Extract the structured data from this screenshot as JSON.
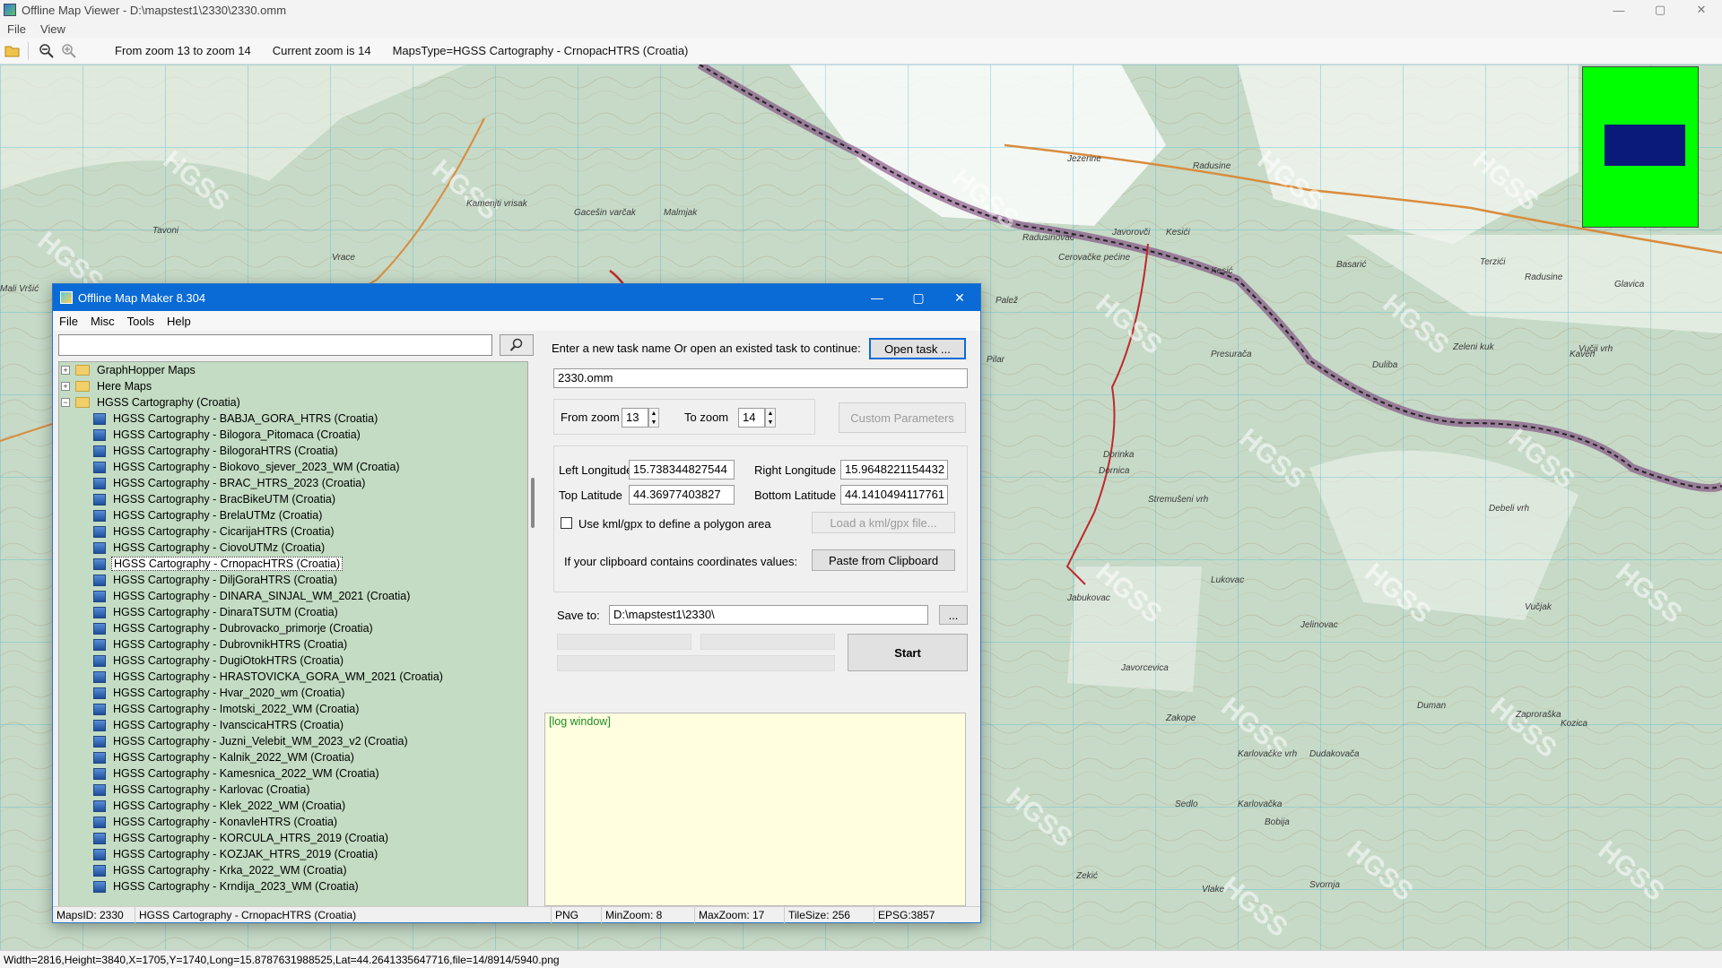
{
  "window": {
    "title": "Offline Map Viewer - D:\\mapstest1\\2330\\2330.omm",
    "controls": [
      "—",
      "▢",
      "✕"
    ]
  },
  "menu": [
    "File",
    "View"
  ],
  "toolbar": {
    "zoom_range": "From zoom 13 to zoom 14",
    "current_zoom": "Current zoom is 14",
    "maps_type": "MapsType=HGSS Cartography - CrnopacHTRS (Croatia)",
    "icons": [
      "open-folder-icon",
      "zoom-out-icon",
      "zoom-in-icon"
    ]
  },
  "map": {
    "watermark": "HGSS",
    "labels": [
      "Tavoni",
      "Vrace",
      "Kamenjti vrisak",
      "Gacešin varčak",
      "Malmjak",
      "Jezerine",
      "Radusinovac",
      "Radusine",
      "Cerovačke pećine",
      "Palež",
      "Javorovči",
      "Kesići",
      "Kesić",
      "Terzići",
      "Radusine",
      "Glavica",
      "Basarić",
      "Vučji vrh",
      "Mali Vršić",
      "Dorinka",
      "Presurača",
      "Duliba",
      "Kaven",
      "Lukovac",
      "Jabukovac",
      "Jelinovac",
      "Javorcevica",
      "Duman",
      "Zaproraška",
      "Vučjak",
      "Kozica",
      "Zakope",
      "Dudakovača",
      "Karlovačke vrh",
      "Vlake",
      "Zekić",
      "Svornja",
      "Sedlo",
      "Bobija",
      "Zeleni kuk",
      "Debeli vrh",
      "Karlovačka",
      "Stremušeni vrh",
      "Dornica",
      "Pilar"
    ],
    "overview": {
      "bg": "#00ff00",
      "viewport": "#0a1a7a"
    }
  },
  "statusbar": "Width=2816,Height=3840,X=1705,Y=1740,Long=15.8787631988525,Lat=44.2641335647716,file=14/8914/5940.png",
  "dialog": {
    "title": "Offline Map Maker 8.304",
    "menu": [
      "File",
      "Misc",
      "Tools",
      "Help"
    ],
    "search_value": "",
    "tree": {
      "folders": [
        {
          "label": "GraphHopper Maps",
          "expander": "+"
        },
        {
          "label": "Here Maps",
          "expander": "+"
        },
        {
          "label": "HGSS Cartography (Croatia)",
          "expander": "−"
        }
      ],
      "children": [
        "HGSS Cartography - BABJA_GORA_HTRS (Croatia)",
        "HGSS Cartography - Bilogora_Pitomaca (Croatia)",
        "HGSS Cartography - BilogoraHTRS (Croatia)",
        "HGSS Cartography - Biokovo_sjever_2023_WM (Croatia)",
        "HGSS Cartography - BRAC_HTRS_2023 (Croatia)",
        "HGSS Cartography - BracBikeUTM (Croatia)",
        "HGSS Cartography - BrelaUTMz (Croatia)",
        "HGSS Cartography - CicarijaHTRS (Croatia)",
        "HGSS Cartography - CiovoUTMz (Croatia)",
        "HGSS Cartography - CrnopacHTRS (Croatia)",
        "HGSS Cartography - DiljGoraHTRS (Croatia)",
        "HGSS Cartography - DINARA_SINJAL_WM_2021 (Croatia)",
        "HGSS Cartography - DinaraTSUTM (Croatia)",
        "HGSS Cartography - Dubrovacko_primorje (Croatia)",
        "HGSS Cartography - DubrovnikHTRS (Croatia)",
        "HGSS Cartography - DugiOtokHTRS (Croatia)",
        "HGSS Cartography - HRASTOVICKA_GORA_WM_2021 (Croatia)",
        "HGSS Cartography - Hvar_2020_wm (Croatia)",
        "HGSS Cartography - Imotski_2022_WM (Croatia)",
        "HGSS Cartography - IvanscicaHTRS (Croatia)",
        "HGSS Cartography - Juzni_Velebit_WM_2023_v2 (Croatia)",
        "HGSS Cartography - Kalnik_2022_WM (Croatia)",
        "HGSS Cartography - Kamesnica_2022_WM (Croatia)",
        "HGSS Cartography - Karlovac (Croatia)",
        "HGSS Cartography - Klek_2022_WM (Croatia)",
        "HGSS Cartography - KonavleHTRS (Croatia)",
        "HGSS Cartography - KORCULA_HTRS_2019 (Croatia)",
        "HGSS Cartography - KOZJAK_HTRS_2019 (Croatia)",
        "HGSS Cartography - Krka_2022_WM (Croatia)",
        "HGSS Cartography - Krndija_2023_WM (Croatia)"
      ],
      "selected_index": 9
    },
    "task_prompt": "Enter a new task name Or open an existed task to continue:",
    "open_task_btn": "Open task ...",
    "task_name": "2330.omm",
    "from_zoom_label": "From zoom",
    "from_zoom": "13",
    "to_zoom_label": "To zoom",
    "to_zoom": "14",
    "custom_params_btn": "Custom Parameters",
    "left_lon_label": "Left Longitude",
    "left_lon": "15.738344827544",
    "right_lon_label": "Right Longitude",
    "right_lon": "15.9648221154432",
    "top_lat_label": "Top Latitude",
    "top_lat": "44.36977403827",
    "bottom_lat_label": "Bottom Latitude",
    "bottom_lat": "44.1410494117761",
    "kml_label": "Use kml/gpx to define a polygon area",
    "load_kml_btn": "Load a kml/gpx file...",
    "clipboard_label": "If your clipboard contains coordinates values:",
    "paste_btn": "Paste from Clipboard",
    "save_to_label": "Save to:",
    "save_to": "D:\\mapstest1\\2330\\",
    "browse_btn": "...",
    "start_btn": "Start",
    "log": "[log window]",
    "status": {
      "maps_id": "MapsID: 2330",
      "maps_name": "HGSS Cartography - CrnopacHTRS (Croatia)",
      "format": "PNG",
      "min_zoom": "MinZoom: 8",
      "max_zoom": "MaxZoom: 17",
      "tile_size": "TileSize: 256",
      "epsg": "EPSG:3857"
    }
  }
}
